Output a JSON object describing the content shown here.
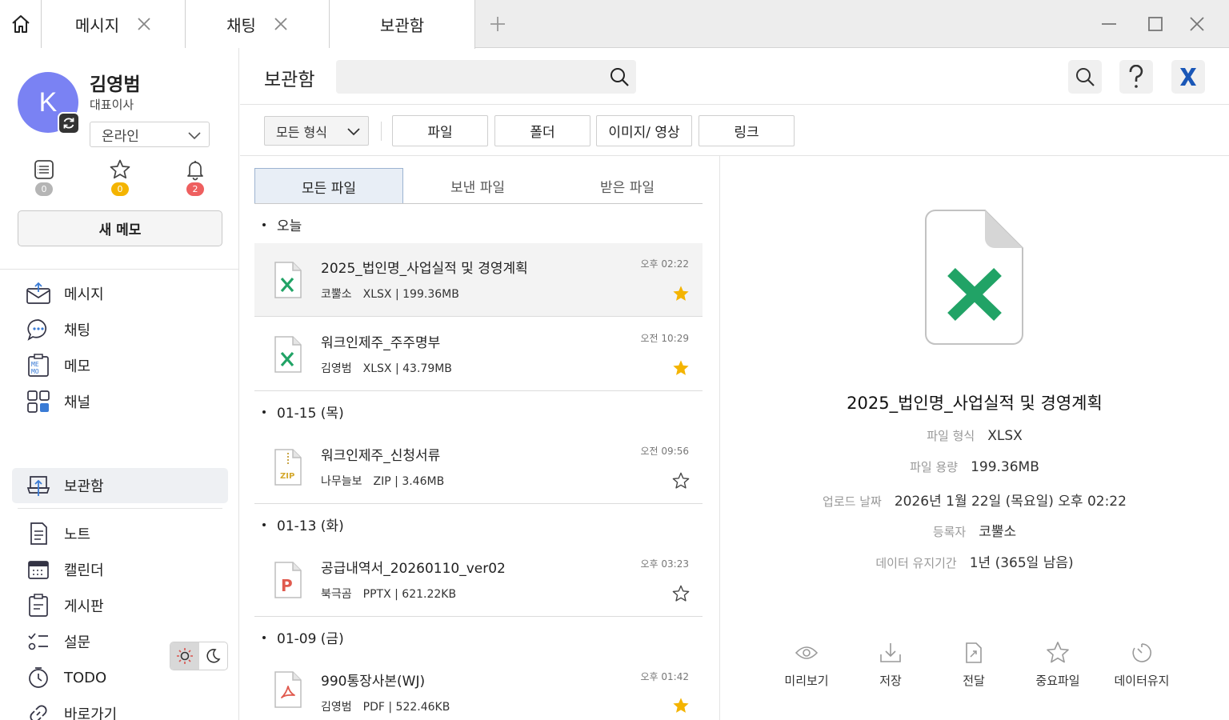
{
  "tabs": [
    {
      "label": "메시지",
      "closable": true
    },
    {
      "label": "채팅",
      "closable": true
    },
    {
      "label": "보관함",
      "closable": false,
      "active": true
    }
  ],
  "profile": {
    "initial": "K",
    "name": "김영범",
    "role": "대표이사",
    "status": "온라인",
    "avatar_color": "#7a82f3"
  },
  "quick_counts": [
    {
      "icon": "list-icon",
      "count": "0",
      "color": "#b5b5b5"
    },
    {
      "icon": "star-icon",
      "count": "0",
      "color": "#f4b400"
    },
    {
      "icon": "bell-icon",
      "count": "2",
      "color": "#ee5f5f"
    }
  ],
  "new_memo_label": "새 메모",
  "nav": [
    {
      "label": "메시지",
      "icon": "mail-icon"
    },
    {
      "label": "채팅",
      "icon": "chat-icon"
    },
    {
      "label": "메모",
      "icon": "memo-icon"
    },
    {
      "label": "채널",
      "icon": "channel-icon"
    },
    {
      "label": "보관함",
      "icon": "archive-icon",
      "active": true
    },
    {
      "label": "노트",
      "icon": "note-icon"
    },
    {
      "label": "캘린더",
      "icon": "calendar-icon"
    },
    {
      "label": "게시판",
      "icon": "board-icon"
    },
    {
      "label": "설문",
      "icon": "survey-icon"
    },
    {
      "label": "TODO",
      "icon": "todo-icon"
    },
    {
      "label": "바로가기",
      "icon": "link-icon"
    }
  ],
  "main": {
    "title": "보관함",
    "search_placeholder": ""
  },
  "filters": {
    "format_select": "모든 형식",
    "buttons": [
      "파일",
      "폴더",
      "이미지/ 영상",
      "링크"
    ]
  },
  "subtabs": [
    "모든 파일",
    "보낸 파일",
    "받은 파일"
  ],
  "groups": [
    {
      "label": "오늘",
      "files": [
        {
          "name": "2025_법인명_사업실적 및 경영계획",
          "owner": "코뿔소",
          "type": "XLSX",
          "size": "199.36MB",
          "time": "오후 02:22",
          "starred": true,
          "icon": "excel-file-icon"
        },
        {
          "name": "워크인제주_주주명부",
          "owner": "김영범",
          "type": "XLSX",
          "size": "43.79MB",
          "time": "오전 10:29",
          "starred": true,
          "icon": "excel-file-icon"
        }
      ]
    },
    {
      "label": "01-15 (목)",
      "files": [
        {
          "name": "워크인제주_신청서류",
          "owner": "나무늘보",
          "type": "ZIP",
          "size": "3.46MB",
          "time": "오전 09:56",
          "starred": false,
          "icon": "zip-file-icon"
        }
      ]
    },
    {
      "label": "01-13 (화)",
      "files": [
        {
          "name": "공급내역서_20260110_ver02",
          "owner": "북극곰",
          "type": "PPTX",
          "size": "621.22KB",
          "time": "오후 03:23",
          "starred": false,
          "icon": "ppt-file-icon"
        }
      ]
    },
    {
      "label": "01-09 (금)",
      "files": [
        {
          "name": "990통장사본(WJ)",
          "owner": "김영범",
          "type": "PDF",
          "size": "522.46KB",
          "time": "오후 01:42",
          "starred": true,
          "icon": "pdf-file-icon"
        }
      ]
    }
  ],
  "detail": {
    "name": "2025_법인명_사업실적 및 경영계획",
    "rows": [
      {
        "key": "파일 형식",
        "value": "XLSX"
      },
      {
        "key": "파일 용량",
        "value": "199.36MB"
      },
      {
        "key": "업로드 날짜",
        "value": "2026년 1월 22일 (목요일) 오후 02:22"
      },
      {
        "key": "등록자",
        "value": "코뿔소"
      },
      {
        "key": "데이터 유지기간",
        "value": "1년 (365일 남음)"
      }
    ],
    "actions": [
      "미리보기",
      "저장",
      "전달",
      "중요파일",
      "데이터유지"
    ]
  },
  "colors": {
    "excel": "#21a366",
    "star_on": "#f4b400",
    "brand_x": "#1a57b7",
    "pdf": "#e05a4e",
    "ppt": "#e05a4e"
  }
}
